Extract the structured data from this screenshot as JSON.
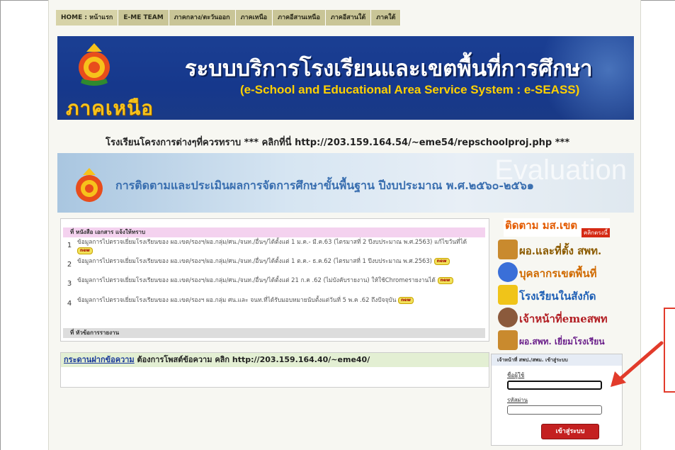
{
  "nav": {
    "items": [
      "HOME : หน้าแรก",
      "E-ME TEAM",
      "ภาคกลาง/ตะวันออก",
      "ภาคเหนือ",
      "ภาคอีสานเหนือ",
      "ภาคอีสานใต้",
      "ภาคใต้"
    ]
  },
  "banner": {
    "title_th": "ระบบบริการโรงเรียนและเขตพื้นที่การศึกษา",
    "title_en": "(e-School and Educational Area Service System : e-SEASS)",
    "region": "ภาคเหนือ"
  },
  "marquee": "โรงเรียนโครงการต่างๆที่ควรทราบ *** คลิกที่นี่ http://203.159.164.54/~eme54/repschoolproj.php ***",
  "eval_banner": {
    "text": "การติดตามและประเมินผลการจัดการศึกษาขั้นพื้นฐาน ปีงบประมาณ พ.ศ.๒๕๖๐-๒๕๖๑",
    "watermark": "Evaluation"
  },
  "news": {
    "header": "ที่ หนังสือ เอกสาร แจ้งให้ทราบ",
    "items": [
      {
        "num": "1",
        "text": "ข้อมูลการไปตรวจเยี่ยมโรงเรียนของ ผอ.เขต/รองฯ/ผอ.กลุ่ม/ศน./จนท./อื่นๆ/ได้ตั้งแต่ 1 ม.ค.- มี.ค.63 (ไตรมาสที่ 2 ปีงบประมาณ พ.ศ.2563) แก้ไขวันที่ได้"
      },
      {
        "num": "2",
        "text": "ข้อมูลการไปตรวจเยี่ยมโรงเรียนของ ผอ.เขต/รองฯ/ผอ.กลุ่ม/ศน./จนท./อื่นๆ/ได้ตั้งแต่ 1 ต.ค.- ธ.ค.62 (ไตรมาสที่ 1 ปีงบประมาณ พ.ศ.2563)"
      },
      {
        "num": "3",
        "text": "ข้อมูลการไปตรวจเยี่ยมโรงเรียนของ ผอ.เขต/รองฯ/ผอ.กลุ่ม/ศน./จนท./อื่นๆ/ได้ตั้งแต่ 21 ก.ค .62 (ไม่บังคับรายงาน) ให้ใช้Chromeรายงานได้"
      },
      {
        "num": "4",
        "text": "ข้อมูลการไปตรวจเยี่ยมโรงเรียนของ ผอ.เขต/รองฯ ผอ.กลุ่ม ศน.และ จนท.ที่ได้รับมอบหมายนับตั้งแต่วันที่ 5 พ.ค .62 ถึงปัจจุบัน"
      }
    ],
    "new_badge": "new",
    "footer_header": "ที่ หัวข้อการรายงาน"
  },
  "board": {
    "link": "กระดานฝากข้อความ",
    "text": " ต้องการโพสต์ข้อความ คลิก http://203.159.164.40/~eme40/"
  },
  "side": {
    "title": "ติดตาม มส.เขต",
    "subtitle": "คลิกตรงนี้",
    "items": [
      {
        "label": "ผอ.และที่ตั้ง สพท.",
        "color": "#b8860b"
      },
      {
        "label": "บุคลากรเขตพื้นที่",
        "color": "#e07b00"
      },
      {
        "label": "โรงเรียนในสังกัด",
        "color": "#1e5fb5"
      },
      {
        "label": "เจ้าหน้าที่emeสพท",
        "color": "#b32025"
      },
      {
        "label": "ผอ.สพท. เยี่ยมโรงเรียน",
        "color": "#6a1f8a"
      }
    ]
  },
  "login": {
    "header": "เจ้าหน้าที่ สพป./สพม. เข้าสู่ระบบ",
    "user_label": "ชื่อผู้ใช้",
    "pass_label": "รหัสผ่าน",
    "button": "เข้าสู่ระบบ"
  },
  "colors": {
    "accent": "#e23b2b",
    "banner": "#1b3f93",
    "gold": "#f7c21b"
  }
}
